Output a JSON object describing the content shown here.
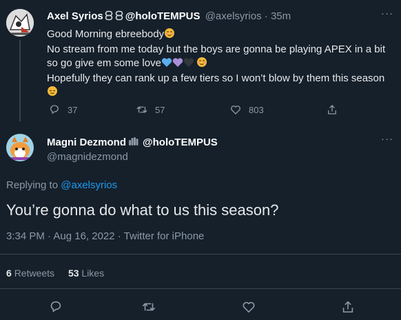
{
  "original_tweet": {
    "display_name": "Axel Syrios",
    "display_name_suffix": "@holoTEMPUS",
    "handle": "@axelsyrios",
    "separator": "·",
    "time": "35m",
    "lines": [
      "Good Morning ebreebody",
      "No stream from me today but the boys are gonna be playing APEX in a bit",
      "so go give em some love",
      "Hopefully they can rank up a few tiers so I won’t blow by them this season"
    ],
    "actions": {
      "replies": "37",
      "retweets": "57",
      "likes": "803"
    }
  },
  "reply_tweet": {
    "display_name": "Magni Dezmond",
    "display_name_suffix": "@holoTEMPUS",
    "handle": "@magnidezmond",
    "replying_to_label": "Replying to",
    "replying_to_handle": "@axelsyrios",
    "text": "You’re gonna do what to us this season?",
    "timestamp": "3:34 PM · Aug 16, 2022 · Twitter for iPhone",
    "retweets_count": "6",
    "retweets_label": "Retweets",
    "likes_count": "53",
    "likes_label": "Likes"
  },
  "more_menu_label": "···",
  "colors": {
    "background": "#15202b",
    "text": "#d9d9d9",
    "muted": "#8b98a5",
    "link": "#1d9bf0",
    "divider": "#38444d"
  },
  "icons": [
    "chain-icon",
    "blushing-face-emoji",
    "relieved-face-emoji",
    "blue-heart-emoji",
    "purple-heart-emoji",
    "black-heart-emoji",
    "waving-hand-icon",
    "reply-icon",
    "retweet-icon",
    "like-icon",
    "share-icon"
  ]
}
